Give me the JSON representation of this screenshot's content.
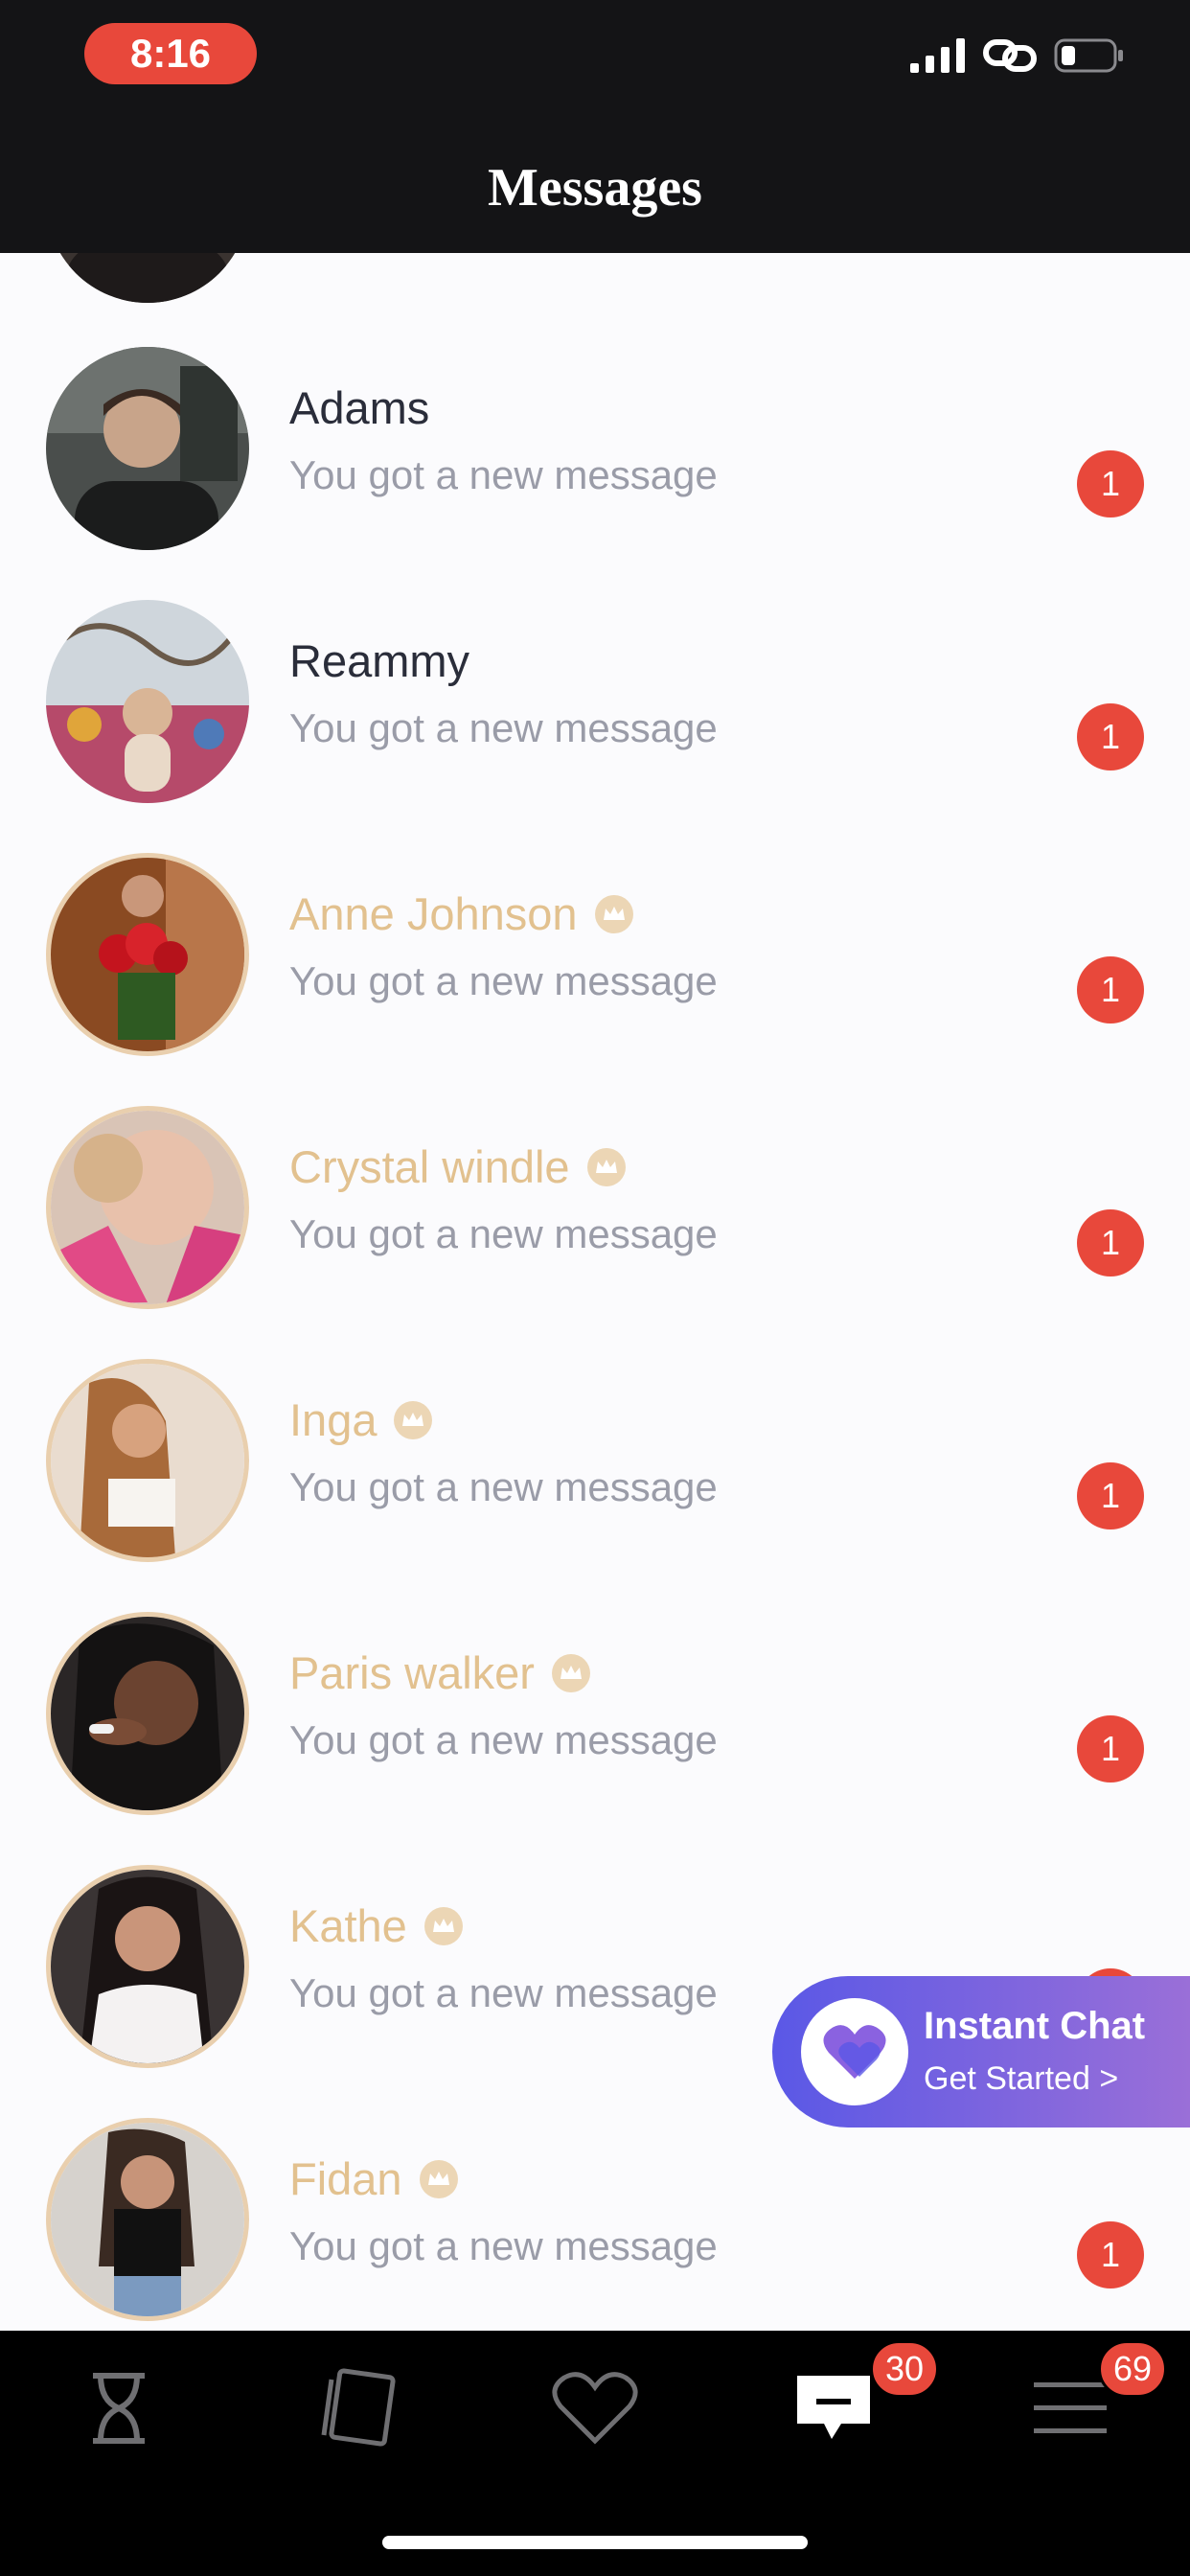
{
  "status_bar": {
    "time": "8:16"
  },
  "header": {
    "title": "Messages"
  },
  "conversations": [
    {
      "name": "Adams",
      "preview": "You got a new message",
      "unread": "1",
      "premium": false
    },
    {
      "name": "Reammy",
      "preview": "You got a new message",
      "unread": "1",
      "premium": false
    },
    {
      "name": "Anne Johnson",
      "preview": "You got a new message",
      "unread": "1",
      "premium": true
    },
    {
      "name": "Crystal windle",
      "preview": "You got a new message",
      "unread": "1",
      "premium": true
    },
    {
      "name": "Inga",
      "preview": "You got a new message",
      "unread": "1",
      "premium": true
    },
    {
      "name": "Paris walker",
      "preview": "You got a new message",
      "unread": "1",
      "premium": true
    },
    {
      "name": "Kathe",
      "preview": "You got a new message",
      "unread": "1",
      "premium": true
    },
    {
      "name": "Fidan",
      "preview": "You got a new message",
      "unread": "1",
      "premium": true
    }
  ],
  "instant_chat": {
    "title": "Instant Chat",
    "subtitle": "Get Started >"
  },
  "tab_bar": {
    "tabs": [
      {
        "icon": "hourglass-icon"
      },
      {
        "icon": "cards-icon"
      },
      {
        "icon": "heart-icon"
      },
      {
        "icon": "chat-icon",
        "badge": "30"
      },
      {
        "icon": "menu-icon",
        "badge": "69"
      }
    ]
  },
  "colors": {
    "accent_red": "#e8483b",
    "premium_gold": "#e2c18f",
    "instant_chat_start": "#5a58e6",
    "instant_chat_end": "#9a6fd8"
  }
}
